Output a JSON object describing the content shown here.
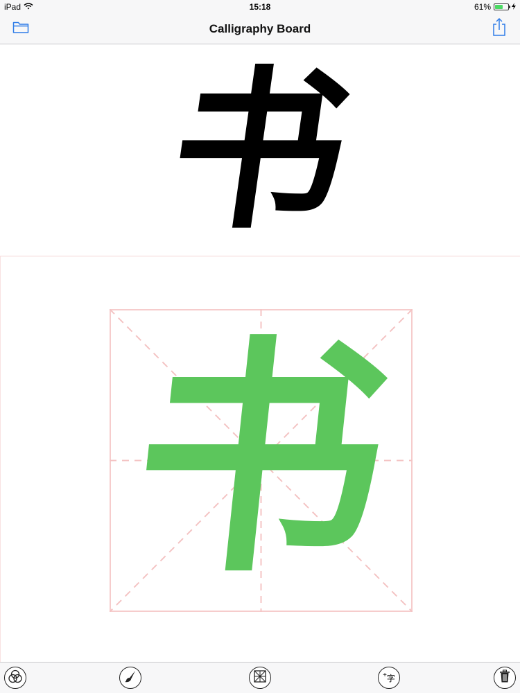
{
  "status_bar": {
    "device": "iPad",
    "time": "15:18",
    "battery_text": "61%",
    "battery_level": 0.61,
    "battery_color": "#4cd964"
  },
  "nav": {
    "title": "Calligraphy Board",
    "left_icon": "folder-icon",
    "right_icon": "share-icon",
    "accent_color": "#2f7ce8"
  },
  "reference": {
    "character": "书"
  },
  "practice": {
    "character": "书",
    "ink_color": "#5cc65c",
    "grid_color": "#f2b6b6"
  },
  "toolbar": {
    "add_label": "字",
    "icons": [
      "color-circles-icon",
      "brush-icon",
      "grid-icon",
      "add-character-icon",
      "trash-icon"
    ]
  }
}
